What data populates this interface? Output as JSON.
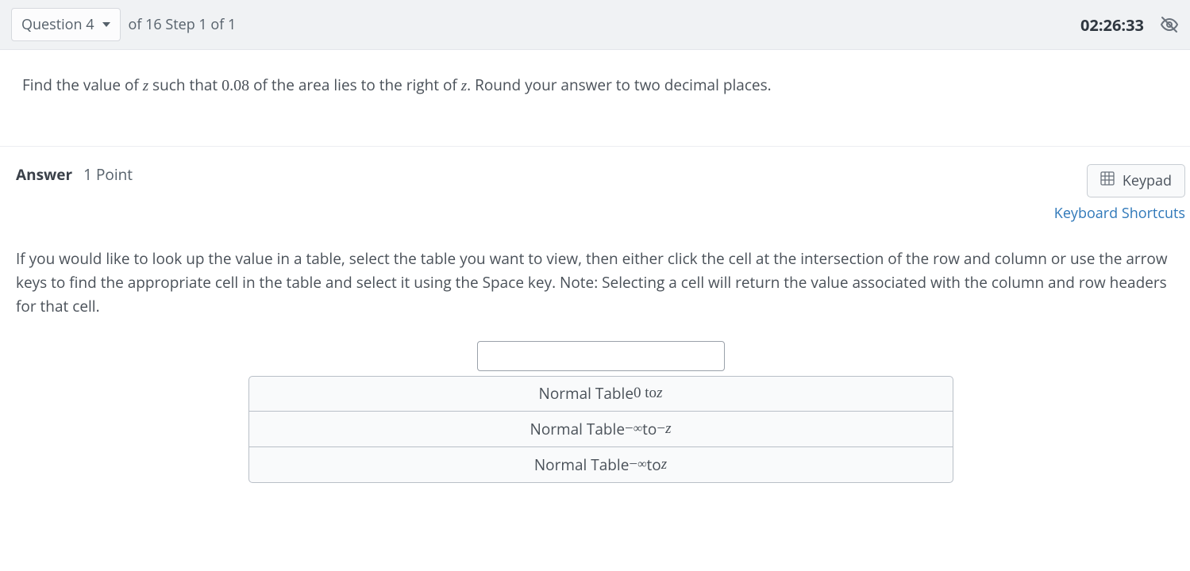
{
  "header": {
    "question_label": "Question 4",
    "of_step": "of 16 Step 1 of 1",
    "timer": "02:26:33"
  },
  "question": {
    "prefix": "Find the value of ",
    "var1": "z",
    "mid1": " such that ",
    "value": "0.08",
    "mid2": " of the area lies to the right of ",
    "var2": "z",
    "suffix": ". Round your answer to two decimal places."
  },
  "answer": {
    "label": "Answer",
    "points": "1 Point",
    "keypad": "Keypad",
    "keyboard_shortcuts": "Keyboard Shortcuts",
    "instructions": "If you would like to look up the value in a table, select the table you want to view, then either click the cell at the intersection of the row and column or use the arrow keys to find the appropriate cell in the table and select it using the Space key. Note: Selecting a cell will return the value associated with the column and row headers for that cell.",
    "input_value": ""
  },
  "tables": {
    "t1_prefix": "Normal Table ",
    "t1_range": "0 to ",
    "t1_z": "z",
    "t2_prefix": "Normal Table ",
    "t2_neg": "−",
    "t2_inf": "∞",
    "t2_to": " to ",
    "t2_neg2": "−",
    "t2_z": "z",
    "t3_prefix": "Normal Table ",
    "t3_neg": "−",
    "t3_inf": "∞",
    "t3_to": " to ",
    "t3_z": "z"
  }
}
